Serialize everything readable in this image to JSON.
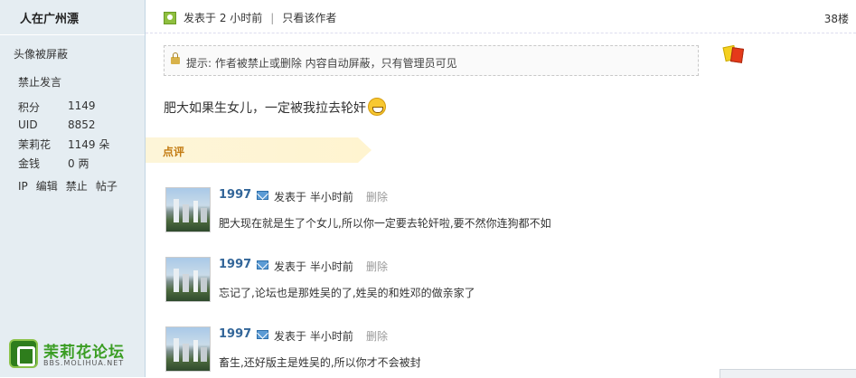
{
  "sidebar": {
    "author_name": "人在广州漂",
    "avatar_blocked": "头像被屏蔽",
    "banned": "禁止发言",
    "stats": [
      {
        "label": "积分",
        "value": "1149"
      },
      {
        "label": "UID",
        "value": "8852"
      },
      {
        "label": "茉莉花",
        "value": "1149 朵"
      },
      {
        "label": "金钱",
        "value": "0 两"
      }
    ],
    "actions": [
      "IP",
      "编辑",
      "禁止",
      "帖子"
    ],
    "logo_title": "茉莉花论坛",
    "logo_sub": "BBS.MOLIHUA.NET"
  },
  "post": {
    "posted": "发表于 2 小时前",
    "separator": "|",
    "only_author": "只看该作者",
    "floor": "38楼",
    "notice": "提示: 作者被禁止或删除 内容自动屏蔽，只有管理员可见",
    "content": "肥大如果生女儿，一定被我拉去轮奸"
  },
  "comments": {
    "header": "点评",
    "items": [
      {
        "user": "1997",
        "time": "发表于 半小时前",
        "delete": "删除",
        "text": "肥大现在就是生了个女儿,所以你一定要去轮奸啦,要不然你连狗都不如"
      },
      {
        "user": "1997",
        "time": "发表于 半小时前",
        "delete": "删除",
        "text": "忘记了,论坛也是那姓吴的了,姓吴的和姓邓的做亲家了"
      },
      {
        "user": "1997",
        "time": "发表于 半小时前",
        "delete": "删除",
        "text": "畜生,还好版主是姓吴的,所以你才不会被封"
      }
    ]
  },
  "colors": {
    "username": "#336699",
    "accent": "#c37b12",
    "sidebar_bg": "#e5edf2"
  },
  "icons": [
    "online-status-icon",
    "lock-icon",
    "warning-card-icon",
    "grin-smiley-icon",
    "mail-icon"
  ]
}
